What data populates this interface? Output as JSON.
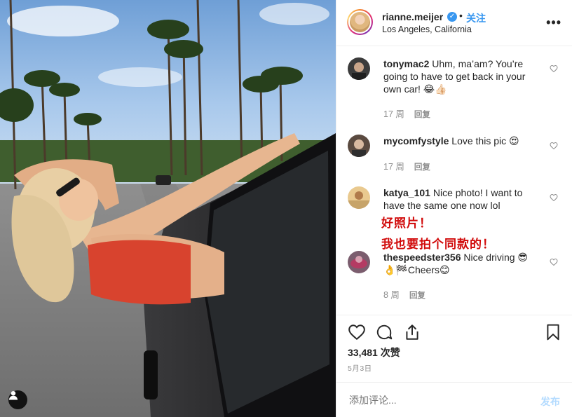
{
  "post": {
    "username": "rianne.meijer",
    "verified_icon": "verified-badge-icon",
    "verified_glyph": "✓",
    "separator": "•",
    "follow_label": "关注",
    "location": "Los Angeles, California",
    "more_label": "•••"
  },
  "comments": [
    {
      "user": "tonymac2",
      "text": " Uhm, ma’am? You’re going to have to get back in your own car! 😂👍🏻",
      "time": "17 周",
      "reply": "回复"
    },
    {
      "user": "mycomfystyle",
      "text": " Love this pic 😍",
      "time": "17 周",
      "reply": "回复"
    },
    {
      "user": "katya_101",
      "text": " Nice photo! I want to have the same one now lol",
      "time": "",
      "reply": ""
    },
    {
      "user": "thespeedster356",
      "text": " Nice driving 😎 👌🏁Cheers😊",
      "time": "8 周",
      "reply": "回复"
    }
  ],
  "translation_overlay": {
    "line1": "好照片！",
    "line2": "我也要拍个同款的！"
  },
  "actions": {
    "likes": "33,481 次赞",
    "date": "5月3日"
  },
  "comment_box": {
    "placeholder": "添加评论...",
    "post_label": "发布"
  },
  "colors": {
    "link_blue": "#3897f0",
    "overlay_red": "#d10b0b",
    "muted_gray": "#8e8e8e",
    "post_disabled": "#b3dbff"
  }
}
